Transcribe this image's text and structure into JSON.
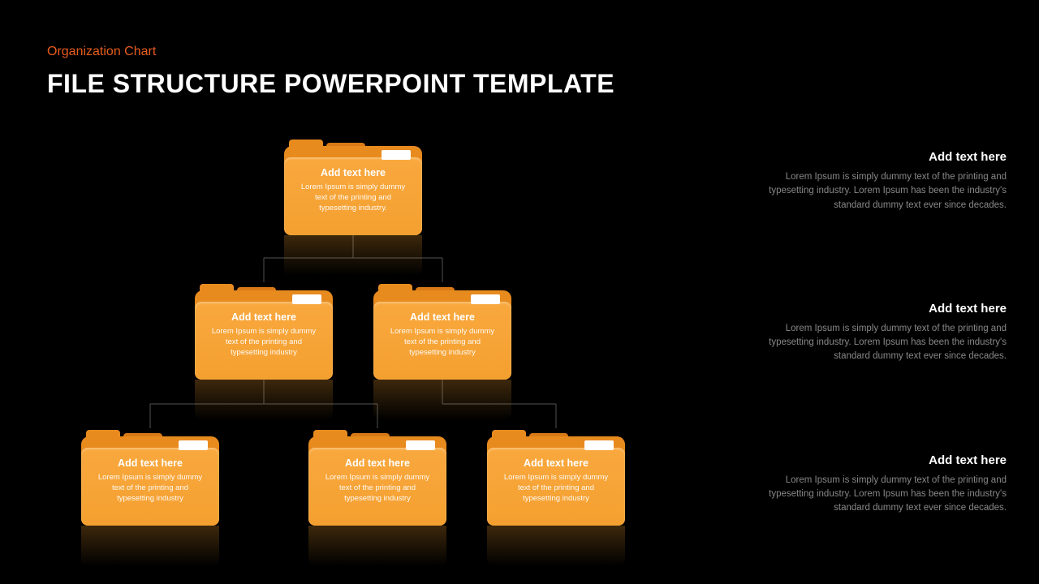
{
  "header": {
    "subtitle": "Organization Chart",
    "title": "FILE STRUCTURE POWERPOINT TEMPLATE"
  },
  "folders": {
    "top": {
      "title": "Add text here",
      "body": "Lorem Ipsum is simply dummy text of the printing and typesetting industry."
    },
    "mid_left": {
      "title": "Add text here",
      "body": "Lorem Ipsum is simply dummy text of the printing and typesetting industry"
    },
    "mid_right": {
      "title": "Add text here",
      "body": "Lorem Ipsum is simply dummy text of the printing and typesetting industry"
    },
    "bot_left": {
      "title": "Add text here",
      "body": "Lorem Ipsum is simply dummy text of the printing and typesetting industry"
    },
    "bot_mid": {
      "title": "Add text here",
      "body": "Lorem Ipsum is simply dummy text of the printing and typesetting industry"
    },
    "bot_right": {
      "title": "Add text here",
      "body": "Lorem Ipsum is simply dummy text of the printing and typesetting industry"
    }
  },
  "side": {
    "item1": {
      "title": "Add text here",
      "body": "Lorem Ipsum is simply dummy text of the printing and typesetting industry. Lorem Ipsum has been the industry's standard dummy text ever since decades."
    },
    "item2": {
      "title": "Add text here",
      "body": "Lorem Ipsum is simply dummy text of the printing and typesetting industry. Lorem Ipsum has been the industry's standard dummy text ever since decades."
    },
    "item3": {
      "title": "Add text here",
      "body": "Lorem Ipsum is simply dummy text of the printing and typesetting industry. Lorem Ipsum has been the industry's standard dummy text ever since decades."
    }
  }
}
